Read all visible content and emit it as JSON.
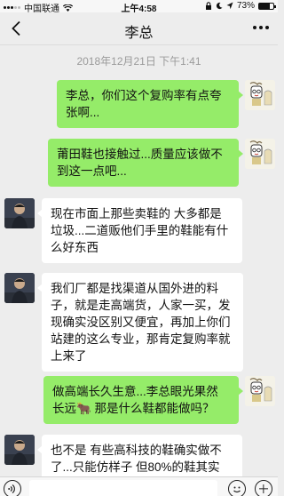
{
  "status_bar": {
    "carrier": "中国联通",
    "wifi_icon": "wifi-icon",
    "time": "上午4:58",
    "battery": "73%",
    "battery_level": 0.73,
    "icons": [
      "screen-lock-icon",
      "do-not-disturb-icon",
      "location-icon",
      "battery-icon"
    ]
  },
  "nav": {
    "title": "李总",
    "back_icon": "chevron-left-icon",
    "more_icon": "more-dots-icon"
  },
  "chat": {
    "timestamp": "2018年12月21日 下午1:41",
    "messages": [
      {
        "sender": "me",
        "text": "李总，你们这个复购率有点夸张啊..."
      },
      {
        "sender": "me",
        "text": "莆田鞋也接触过...质量应该做不到这一点吧..."
      },
      {
        "sender": "them",
        "text": "现在市面上那些卖鞋的 大多都是垃圾...二道贩他们手里的鞋能有什么好东西"
      },
      {
        "sender": "them",
        "text": "我们厂都是找渠道从国外进的料子，就是走高端货，人家一买，发现确实没区别又便宜，再加上你们站建的这么专业，那肯定复购率就上来了"
      },
      {
        "sender": "me",
        "text": "做高端长久生意...李总眼光果然长远🐂 那是什么鞋都能做吗？"
      },
      {
        "sender": "them",
        "text": "也不是 有些高科技的鞋确实做不了...只能仿样子 但80%的鞋其实"
      }
    ]
  },
  "input_bar": {
    "voice_icon": "voice-icon",
    "emoji_icon": "emoji-icon",
    "plus_icon": "plus-icon"
  },
  "colors": {
    "my_bubble": "#95ec69",
    "their_bubble": "#ffffff",
    "background": "#ededed"
  }
}
